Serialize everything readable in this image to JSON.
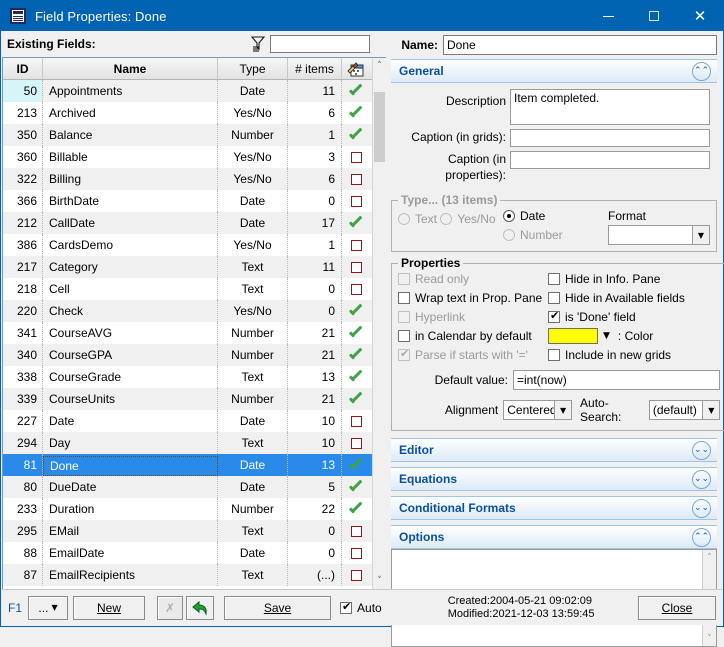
{
  "window": {
    "title": "Field Properties: Done",
    "icon": "grid-window-icon",
    "controls": {
      "minimize": "–",
      "maximize": "□",
      "close": "✕"
    }
  },
  "left": {
    "existing_fields_label": "Existing Fields:",
    "filter_icon": "filter-icon",
    "filter_value": "",
    "columns": [
      "ID",
      "Name",
      "Type",
      "# items",
      ""
    ],
    "checkbox_column_icon": "stamp-icon",
    "rows": [
      {
        "id": "50",
        "name": "Appointments",
        "type": "Date",
        "items": "11",
        "checked": true
      },
      {
        "id": "213",
        "name": "Archived",
        "type": "Yes/No",
        "items": "6",
        "checked": true
      },
      {
        "id": "350",
        "name": "Balance",
        "type": "Number",
        "items": "1",
        "checked": true
      },
      {
        "id": "360",
        "name": "Billable",
        "type": "Yes/No",
        "items": "3",
        "checked": false
      },
      {
        "id": "322",
        "name": "Billing",
        "type": "Yes/No",
        "items": "6",
        "checked": false
      },
      {
        "id": "366",
        "name": "BirthDate",
        "type": "Date",
        "items": "0",
        "checked": false
      },
      {
        "id": "212",
        "name": "CallDate",
        "type": "Date",
        "items": "17",
        "checked": true
      },
      {
        "id": "386",
        "name": "CardsDemo",
        "type": "Yes/No",
        "items": "1",
        "checked": false
      },
      {
        "id": "217",
        "name": "Category",
        "type": "Text",
        "items": "11",
        "checked": false
      },
      {
        "id": "218",
        "name": "Cell",
        "type": "Text",
        "items": "0",
        "checked": false
      },
      {
        "id": "220",
        "name": "Check",
        "type": "Yes/No",
        "items": "0",
        "checked": true
      },
      {
        "id": "341",
        "name": "CourseAVG",
        "type": "Number",
        "items": "21",
        "checked": true
      },
      {
        "id": "340",
        "name": "CourseGPA",
        "type": "Number",
        "items": "21",
        "checked": true
      },
      {
        "id": "338",
        "name": "CourseGrade",
        "type": "Text",
        "items": "13",
        "checked": true
      },
      {
        "id": "339",
        "name": "CourseUnits",
        "type": "Number",
        "items": "21",
        "checked": true
      },
      {
        "id": "227",
        "name": "Date",
        "type": "Date",
        "items": "10",
        "checked": false
      },
      {
        "id": "294",
        "name": "Day",
        "type": "Text",
        "items": "10",
        "checked": false
      },
      {
        "id": "81",
        "name": "Done",
        "type": "Date",
        "items": "13",
        "checked": true,
        "selected": true
      },
      {
        "id": "80",
        "name": "DueDate",
        "type": "Date",
        "items": "5",
        "checked": true
      },
      {
        "id": "233",
        "name": "Duration",
        "type": "Number",
        "items": "22",
        "checked": true
      },
      {
        "id": "295",
        "name": "EMail",
        "type": "Text",
        "items": "0",
        "checked": false
      },
      {
        "id": "88",
        "name": "EmailDate",
        "type": "Date",
        "items": "0",
        "checked": false
      },
      {
        "id": "87",
        "name": "EmailRecipients",
        "type": "Text",
        "items": "(...)",
        "checked": false
      }
    ]
  },
  "right": {
    "name_label": "Name:",
    "name_value": "Done",
    "sections": {
      "general": {
        "title": "General",
        "expanded": true,
        "chevron": "chevron-up-icon"
      },
      "editor": {
        "title": "Editor",
        "expanded": false,
        "chevron": "chevron-down-icon"
      },
      "equations": {
        "title": "Equations",
        "expanded": false,
        "chevron": "chevron-down-icon"
      },
      "conditional_formats": {
        "title": "Conditional Formats",
        "expanded": false,
        "chevron": "chevron-down-icon"
      },
      "options": {
        "title": "Options",
        "expanded": true,
        "chevron": "chevron-up-icon",
        "value": ""
      }
    },
    "general": {
      "description_label": "Description",
      "description_value": "Item completed.",
      "caption_grids_label": "Caption (in grids):",
      "caption_grids_value": "",
      "caption_props_label": "Caption (in properties):",
      "caption_props_value": ""
    },
    "type_group": {
      "legend": "Type...  (13 items)",
      "options": [
        {
          "label": "Text",
          "selected": false,
          "disabled": true
        },
        {
          "label": "Date",
          "selected": true,
          "disabled": false
        },
        {
          "label": "Yes/No",
          "selected": false,
          "disabled": true
        },
        {
          "label": "Number",
          "selected": false,
          "disabled": true
        }
      ],
      "format_label": "Format",
      "format_value": ""
    },
    "properties_group": {
      "legend": "Properties",
      "checkboxes": [
        {
          "label": "Read only",
          "checked": false,
          "disabled": true
        },
        {
          "label": "Wrap text in Prop. Pane",
          "checked": false,
          "disabled": false
        },
        {
          "label": "Hyperlink",
          "checked": false,
          "disabled": true
        },
        {
          "label": "in Calendar by default",
          "checked": false,
          "disabled": false
        },
        {
          "label": "Parse if starts with '='",
          "checked": true,
          "disabled": true
        },
        {
          "label": "Hide in Info. Pane",
          "checked": false,
          "disabled": false
        },
        {
          "label": "Hide in Available fields",
          "checked": false,
          "disabled": false
        },
        {
          "label": "is 'Done' field",
          "checked": true,
          "disabled": false
        },
        {
          "label": "Include in new grids",
          "checked": false,
          "disabled": false
        }
      ],
      "color_label": ": Color",
      "color_value": "#FFFF00",
      "default_value_label": "Default value:",
      "default_value": "=int(now)",
      "alignment_label": "Alignment",
      "alignment_value": "Centered",
      "autosearch_label": "Auto-Search:",
      "autosearch_value": "(default)"
    }
  },
  "bottom": {
    "f1": "F1",
    "more_button": "...",
    "new_button": "New",
    "delete_button": "✗",
    "undo_button": "undo-arrow-icon",
    "save_button": "Save",
    "auto_label": "Auto",
    "auto_checked": true,
    "created": "Created:2004-05-21 09:02:09",
    "modified": "Modified:2021-12-03 13:59:45",
    "close_button": "Close"
  }
}
